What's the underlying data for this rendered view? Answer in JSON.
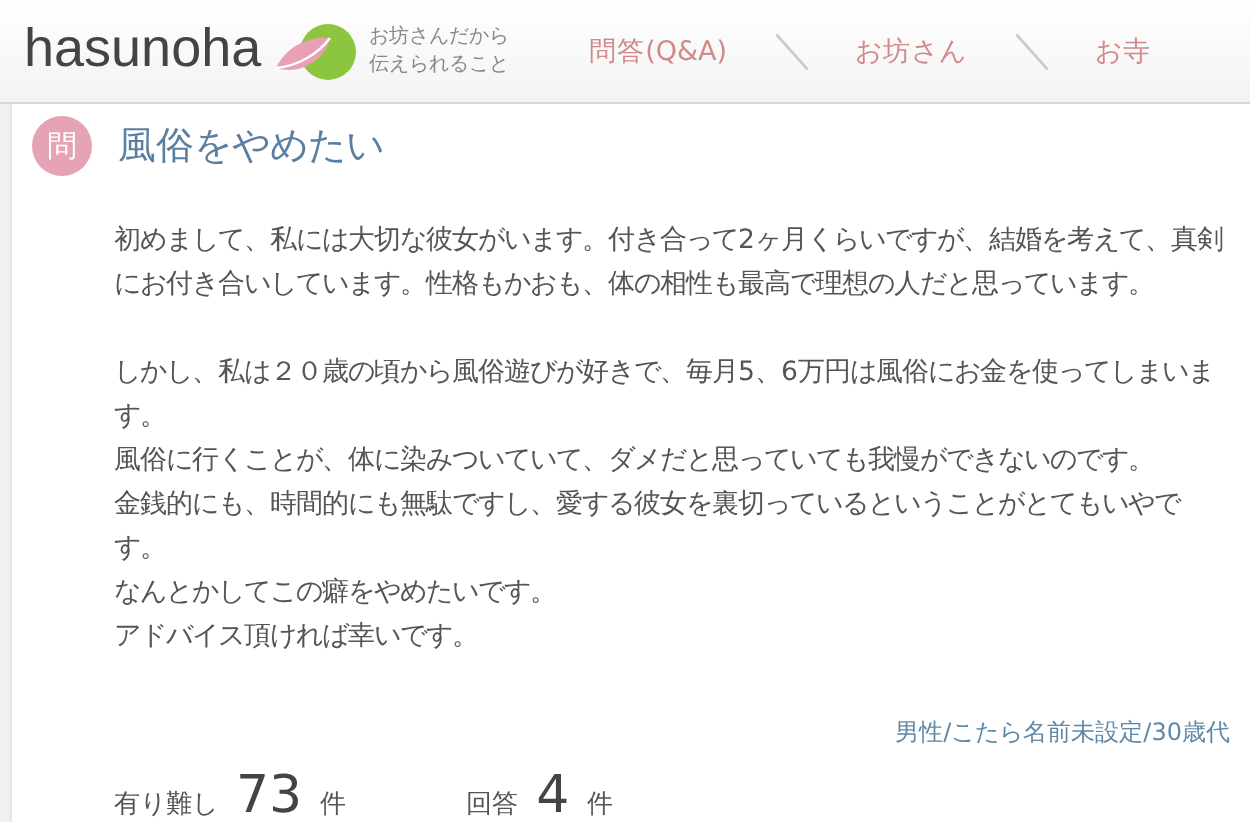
{
  "header": {
    "logo": "hasunoha",
    "tagline": [
      "お坊さんだから",
      "伝えられること"
    ],
    "nav": [
      {
        "label": "問答(Q&A)"
      },
      {
        "label": "お坊さん"
      },
      {
        "label": "お寺"
      }
    ]
  },
  "question": {
    "badge": "問",
    "title": "風俗をやめたい",
    "paragraphs": [
      [
        "初めまして、私には大切な彼女がいます。付き合って2ヶ月くらいですが、結婚を考えて、真剣にお付き合いしています。性格もかおも、体の相性も最高で理想の人だと思っています。"
      ],
      [
        "しかし、私は２０歳の頃から風俗遊びが好きで、毎月5、6万円は風俗にお金を使ってしまいます。",
        "風俗に行くことが、体に染みついていて、ダメだと思っていても我慢ができないのです。",
        "金銭的にも、時間的にも無駄ですし、愛する彼女を裏切っているということがとてもいやです。",
        "なんとかしてこの癖をやめたいです。",
        "アドバイス頂ければ幸いです。"
      ]
    ],
    "author": "男性/こたら名前未設定/30歳代",
    "stats": [
      {
        "label": "有り難し",
        "count": "73",
        "unit": "件"
      },
      {
        "label": "回答",
        "count": "4",
        "unit": "件"
      }
    ]
  }
}
